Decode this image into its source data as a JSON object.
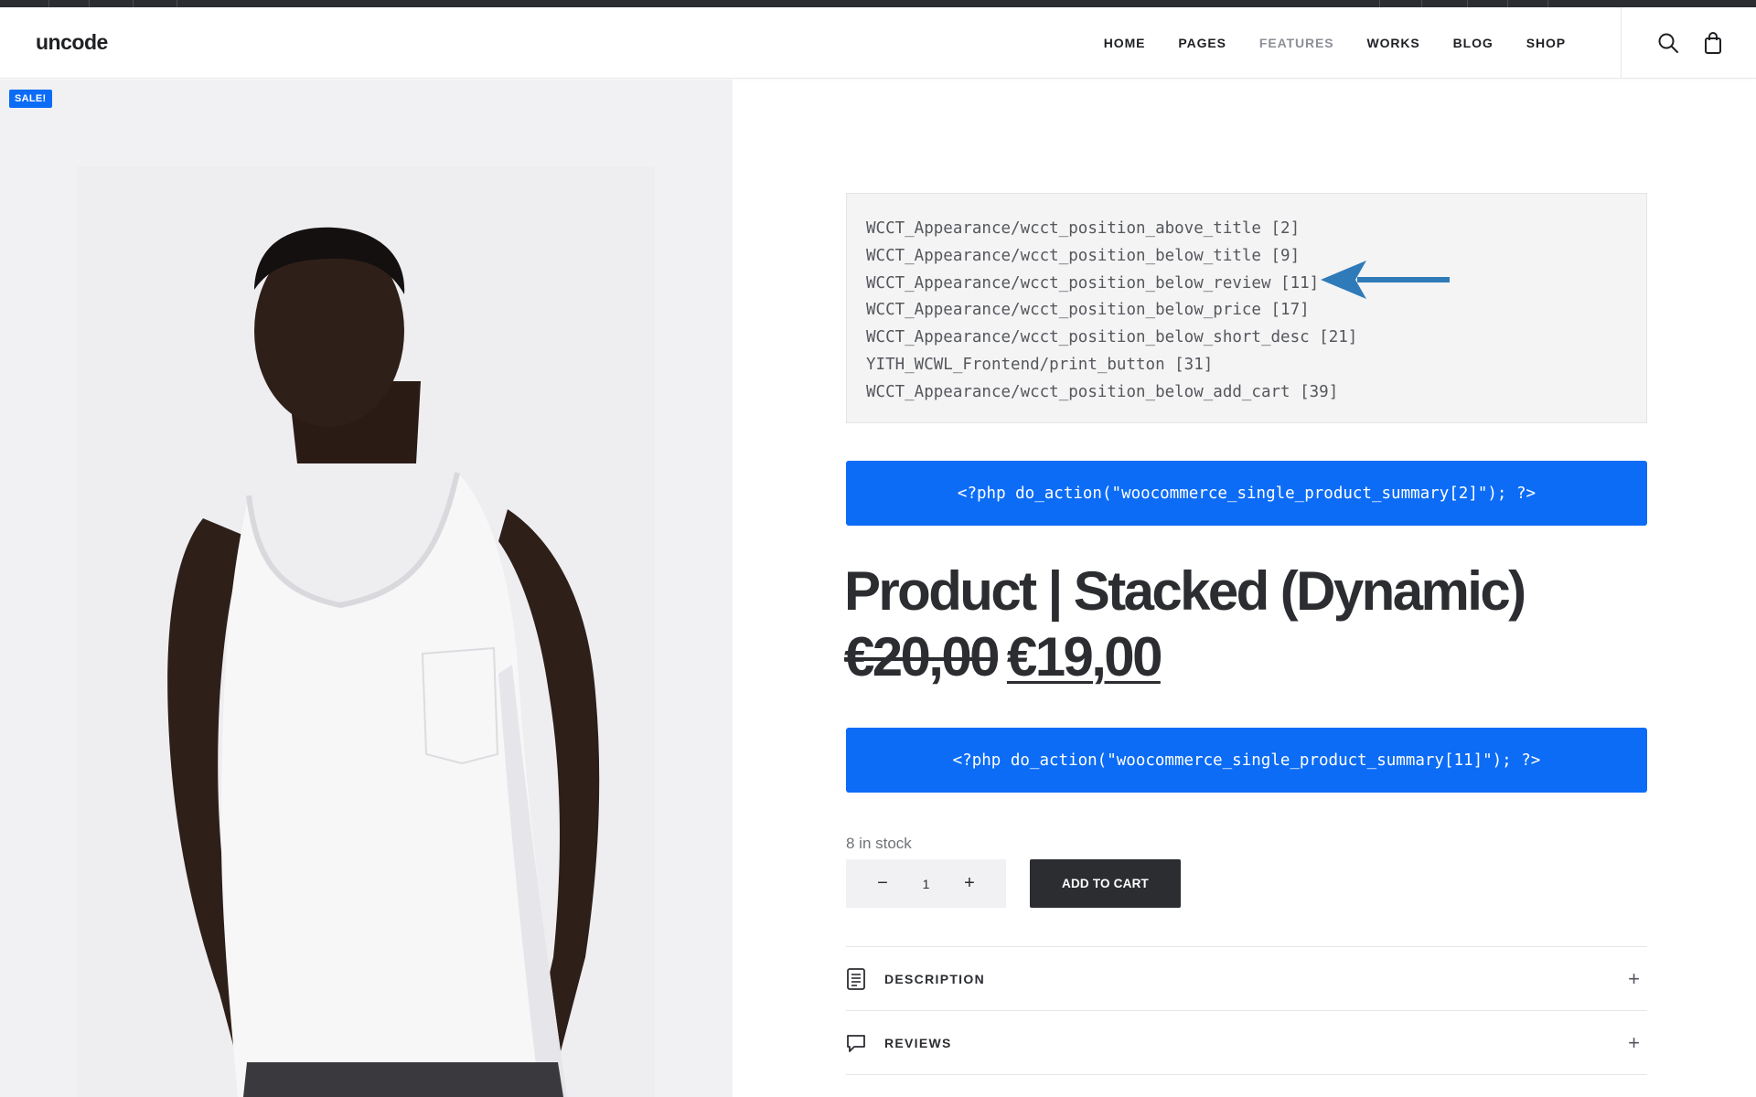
{
  "header": {
    "logo": "uncode",
    "nav": [
      {
        "label": "HOME"
      },
      {
        "label": "PAGES"
      },
      {
        "label": "FEATURES"
      },
      {
        "label": "WORKS"
      },
      {
        "label": "BLOG"
      },
      {
        "label": "SHOP"
      }
    ],
    "icons": [
      "search-icon",
      "shopping-bag-icon"
    ]
  },
  "gallery": {
    "badge": "SALE!"
  },
  "hooks": {
    "lines": [
      "WCCT_Appearance/wcct_position_above_title [2]",
      "WCCT_Appearance/wcct_position_below_title [9]",
      "WCCT_Appearance/wcct_position_below_review [11]",
      "WCCT_Appearance/wcct_position_below_price [17]",
      "WCCT_Appearance/wcct_position_below_short_desc [21]",
      "YITH_WCWL_Frontend/print_button [31]",
      "WCCT_Appearance/wcct_position_below_add_cart [39]"
    ]
  },
  "code_bars": {
    "first": "<?php do_action(\"woocommerce_single_product_summary[2]\"); ?>",
    "second": "<?php do_action(\"woocommerce_single_product_summary[11]\"); ?>"
  },
  "product": {
    "title": "Product | Stacked (Dynamic)",
    "price_old": "€20,00",
    "price_new": "€19,00",
    "stock": "8 in stock",
    "quantity": "1",
    "qty_minus": "−",
    "qty_plus": "+",
    "add_to_cart": "ADD TO CART"
  },
  "accordion": [
    {
      "label": "DESCRIPTION",
      "icon": "document-icon",
      "toggle": "+"
    },
    {
      "label": "REVIEWS",
      "icon": "chat-bubble-icon",
      "toggle": "+"
    }
  ],
  "colors": {
    "accent": "#0c6cf6",
    "dark": "#2b2d31",
    "arrow": "#2f7ab8"
  }
}
